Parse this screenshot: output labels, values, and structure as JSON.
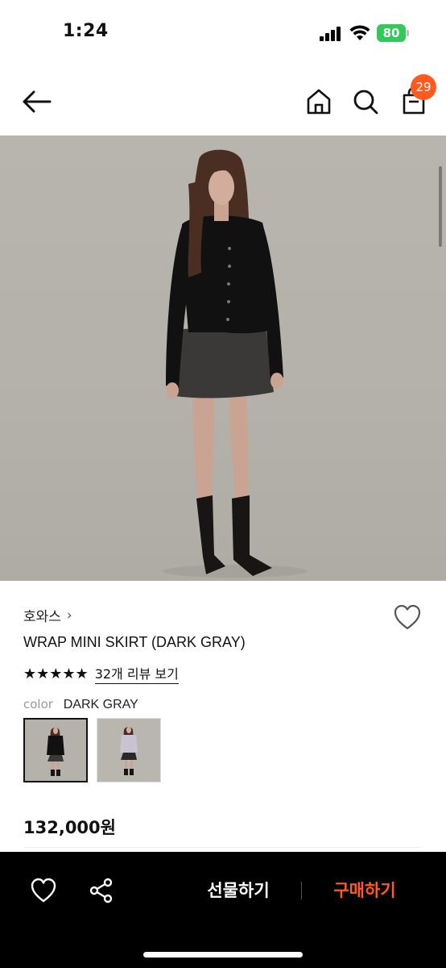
{
  "status_bar": {
    "time": "1:24",
    "battery": "80"
  },
  "header": {
    "cart_count": "29"
  },
  "product": {
    "brand": "호와스",
    "brand_chevron": "›",
    "name": "WRAP MINI SKIRT (DARK GRAY)",
    "rating_stars": "★★★★★",
    "rating_value": 5,
    "review_link": "32개 리뷰 보기",
    "color_label": "color",
    "color_value": "DARK GRAY",
    "price": "132,000원"
  },
  "bottom_bar": {
    "gift_label": "선물하기",
    "buy_label": "구매하기"
  },
  "colors": {
    "accent": "#ff5a1f",
    "battery": "#34c759",
    "bar_bg": "#000000"
  }
}
